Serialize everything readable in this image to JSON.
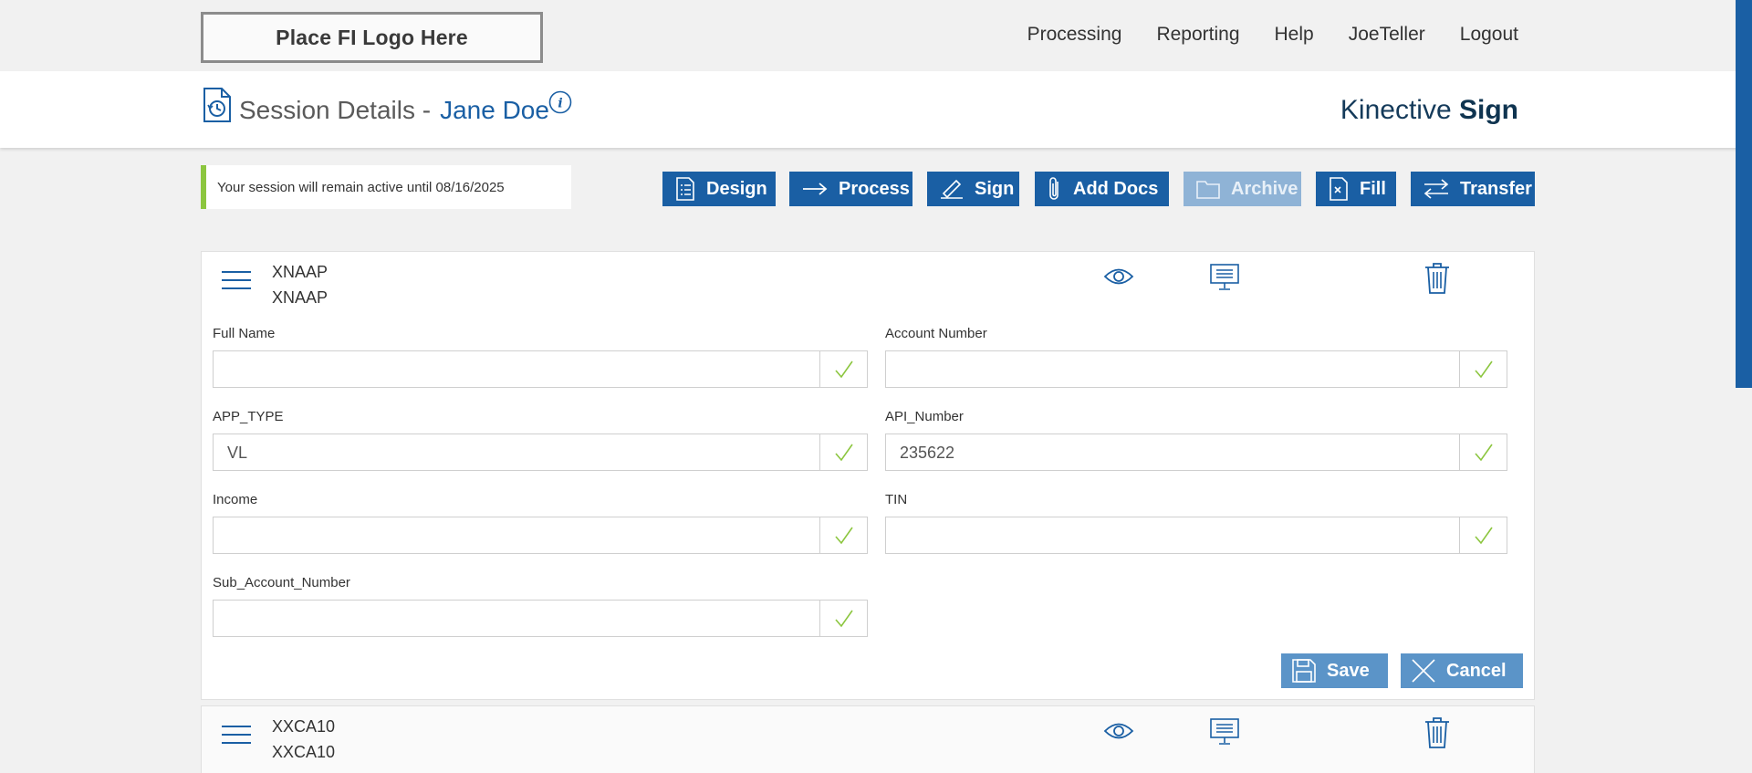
{
  "topbar": {
    "logo_text": "Place FI Logo Here",
    "nav": [
      "Processing",
      "Reporting",
      "Help",
      "JoeTeller",
      "Logout"
    ]
  },
  "header": {
    "title": "Session Details -",
    "customer_name": "Jane Doe",
    "brand_light": "Kinective",
    "brand_bold": "Sign"
  },
  "notice": "Your session will remain active until 08/16/2025",
  "toolbar": {
    "buttons": [
      {
        "label": "Design",
        "icon": "list-icon"
      },
      {
        "label": "Process",
        "icon": "arrow-right-icon"
      },
      {
        "label": "Sign",
        "icon": "pen-icon"
      },
      {
        "label": "Add Docs",
        "icon": "paperclip-icon"
      },
      {
        "label": "Archive",
        "icon": "folder-icon",
        "disabled": true
      },
      {
        "label": "Fill",
        "icon": "document-icon"
      },
      {
        "label": "Transfer",
        "icon": "swap-icon"
      }
    ]
  },
  "documents": [
    {
      "code1": "XNAAP",
      "code2": "XNAAP",
      "fields": [
        {
          "label": "Full Name",
          "value": ""
        },
        {
          "label": "Account Number",
          "value": ""
        },
        {
          "label": "APP_TYPE",
          "value": "VL"
        },
        {
          "label": "API_Number",
          "value": "235622"
        },
        {
          "label": "Income",
          "value": ""
        },
        {
          "label": "TIN",
          "value": ""
        },
        {
          "label": "Sub_Account_Number",
          "value": ""
        }
      ],
      "save_label": "Save",
      "cancel_label": "Cancel"
    },
    {
      "code1": "XXCA10",
      "code2": "XXCA10"
    }
  ],
  "colors": {
    "primary": "#1a5fa4",
    "disabled": "#8fb3d6",
    "action": "#5b94c8",
    "accent_green": "#8cc63f",
    "check_green": "#8cc63f"
  }
}
